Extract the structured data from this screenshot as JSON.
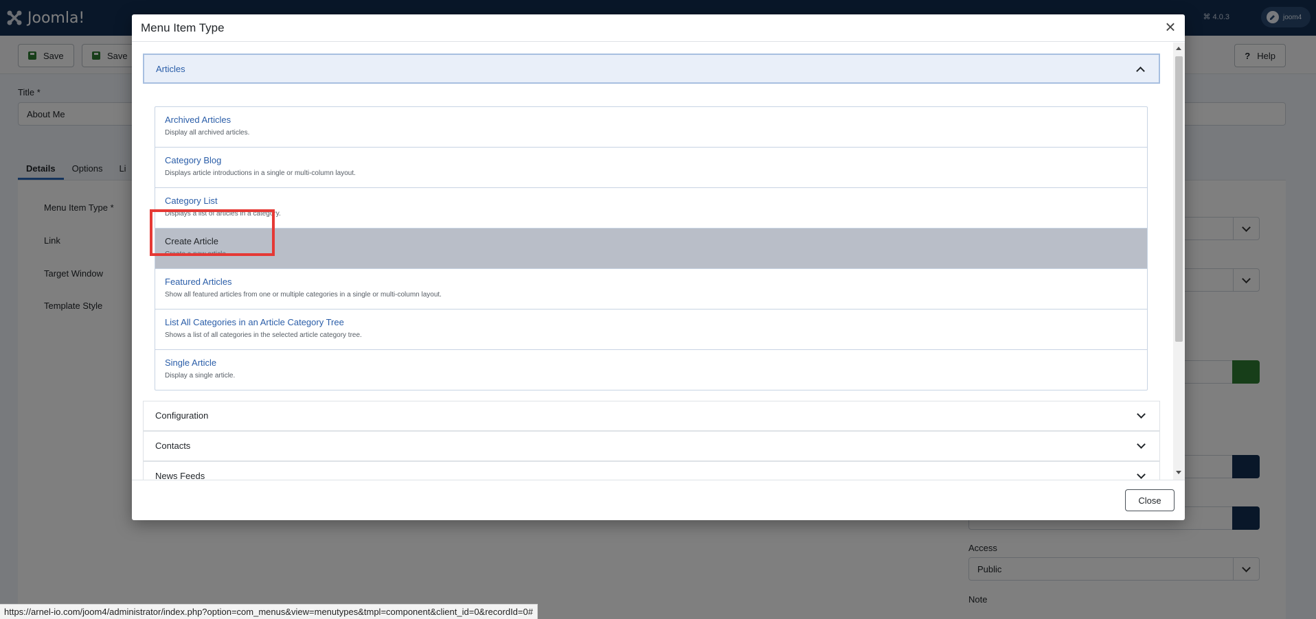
{
  "app": {
    "logo_text": "Joomla!",
    "version": "⌘ 4.0.3",
    "user": "joom4"
  },
  "toolbar": {
    "save_label": "Save",
    "save2_label": "Save",
    "help_label": "Help"
  },
  "form": {
    "title_label": "Title *",
    "title_value": "About Me",
    "tabs": [
      "Details",
      "Options",
      "Li"
    ],
    "fields": [
      "Menu Item Type *",
      "Link",
      "Target Window",
      "Template Style"
    ],
    "access_label": "Access",
    "access_value": "Public",
    "note_label": "Note"
  },
  "modal": {
    "title": "Menu Item Type",
    "close_label": "Close",
    "sections": [
      {
        "label": "Articles",
        "expanded": true
      },
      {
        "label": "Configuration",
        "expanded": false
      },
      {
        "label": "Contacts",
        "expanded": false
      },
      {
        "label": "News Feeds",
        "expanded": false
      }
    ],
    "items": [
      {
        "title": "Archived Articles",
        "desc": "Display all archived articles."
      },
      {
        "title": "Category Blog",
        "desc": "Displays article introductions in a single or multi-column layout."
      },
      {
        "title": "Category List",
        "desc": "Displays a list of articles in a category."
      },
      {
        "title": "Create Article",
        "desc": "Create a new article."
      },
      {
        "title": "Featured Articles",
        "desc": "Show all featured articles from one or multiple categories in a single or multi-column layout."
      },
      {
        "title": "List All Categories in an Article Category Tree",
        "desc": "Shows a list of all categories in the selected article category tree."
      },
      {
        "title": "Single Article",
        "desc": "Display a single article."
      }
    ]
  },
  "statusbar": {
    "url": "https://arnel-io.com/joom4/administrator/index.php?option=com_menus&view=menutypes&tmpl=component&client_id=0&recordId=0#"
  }
}
